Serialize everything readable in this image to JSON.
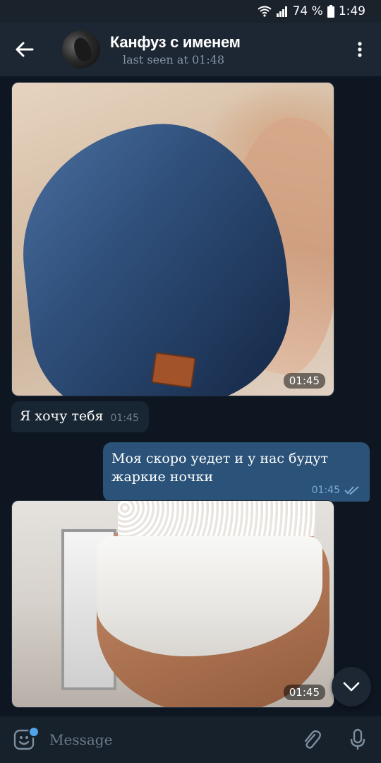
{
  "status": {
    "battery": "74 %",
    "time": "1:49",
    "network": "4G"
  },
  "header": {
    "chat_name": "Канфуз с именем",
    "last_seen": "last seen at 01:48"
  },
  "messages": [
    {
      "type": "photo",
      "direction": "in",
      "time": "01:45"
    },
    {
      "type": "text",
      "direction": "in",
      "text": "Я хочу тебя",
      "time": "01:45"
    },
    {
      "type": "text",
      "direction": "out",
      "text": "Моя скоро уедет и у нас будут жаркие ночки",
      "time": "01:45",
      "status": "read"
    },
    {
      "type": "photo",
      "direction": "in",
      "time": "01:45"
    }
  ],
  "composer": {
    "placeholder": "Message"
  },
  "colors": {
    "background": "#0e1621",
    "header": "#1d2733",
    "incoming_bubble": "#182533",
    "outgoing_bubble": "#2b5278",
    "accent": "#4fa3e6"
  },
  "icons": [
    "back-arrow-icon",
    "more-vert-icon",
    "wifi-icon",
    "signal-icon",
    "battery-icon",
    "double-check-icon",
    "chevron-down-icon",
    "emoji-icon",
    "paperclip-icon",
    "microphone-icon"
  ]
}
